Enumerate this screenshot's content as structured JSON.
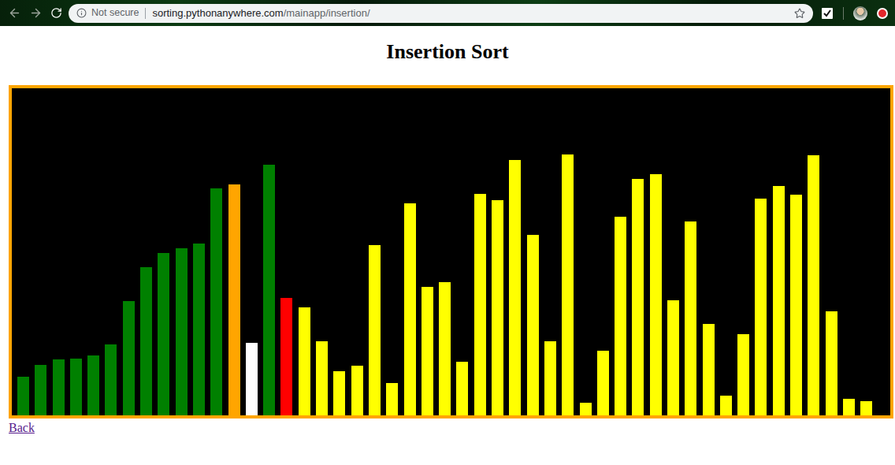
{
  "browser": {
    "security_label": "Not secure",
    "url_host": "sorting.pythonanywhere.com",
    "url_path": "/mainapp/insertion/"
  },
  "page": {
    "title": "Insertion Sort"
  },
  "chart": {
    "bars": [
      {
        "value": 49,
        "color": "#008000"
      },
      {
        "value": 64,
        "color": "#008000"
      },
      {
        "value": 71,
        "color": "#008000"
      },
      {
        "value": 72,
        "color": "#008000"
      },
      {
        "value": 76,
        "color": "#008000"
      },
      {
        "value": 90,
        "color": "#008000"
      },
      {
        "value": 145,
        "color": "#008000"
      },
      {
        "value": 188,
        "color": "#008000"
      },
      {
        "value": 206,
        "color": "#008000"
      },
      {
        "value": 212,
        "color": "#008000"
      },
      {
        "value": 218,
        "color": "#008000"
      },
      {
        "value": 288,
        "color": "#008000"
      },
      {
        "value": 293,
        "color": "#ffa500"
      },
      {
        "value": 92,
        "color": "#ffffff"
      },
      {
        "value": 318,
        "color": "#008000"
      },
      {
        "value": 149,
        "color": "#ff0000"
      },
      {
        "value": 137,
        "color": "#ffff00"
      },
      {
        "value": 94,
        "color": "#ffff00"
      },
      {
        "value": 56,
        "color": "#ffff00"
      },
      {
        "value": 63,
        "color": "#ffff00"
      },
      {
        "value": 216,
        "color": "#ffff00"
      },
      {
        "value": 41,
        "color": "#ffff00"
      },
      {
        "value": 269,
        "color": "#ffff00"
      },
      {
        "value": 163,
        "color": "#ffff00"
      },
      {
        "value": 169,
        "color": "#ffff00"
      },
      {
        "value": 68,
        "color": "#ffff00"
      },
      {
        "value": 281,
        "color": "#ffff00"
      },
      {
        "value": 273,
        "color": "#ffff00"
      },
      {
        "value": 324,
        "color": "#ffff00"
      },
      {
        "value": 229,
        "color": "#ffff00"
      },
      {
        "value": 94,
        "color": "#ffff00"
      },
      {
        "value": 331,
        "color": "#ffff00"
      },
      {
        "value": 16,
        "color": "#ffff00"
      },
      {
        "value": 82,
        "color": "#ffff00"
      },
      {
        "value": 252,
        "color": "#ffff00"
      },
      {
        "value": 300,
        "color": "#ffff00"
      },
      {
        "value": 306,
        "color": "#ffff00"
      },
      {
        "value": 146,
        "color": "#ffff00"
      },
      {
        "value": 246,
        "color": "#ffff00"
      },
      {
        "value": 116,
        "color": "#ffff00"
      },
      {
        "value": 25,
        "color": "#ffff00"
      },
      {
        "value": 103,
        "color": "#ffff00"
      },
      {
        "value": 275,
        "color": "#ffff00"
      },
      {
        "value": 291,
        "color": "#ffff00"
      },
      {
        "value": 280,
        "color": "#ffff00"
      },
      {
        "value": 330,
        "color": "#ffff00"
      },
      {
        "value": 132,
        "color": "#ffff00"
      },
      {
        "value": 21,
        "color": "#ffff00"
      },
      {
        "value": 18,
        "color": "#ffff00"
      }
    ]
  },
  "links": [
    {
      "label": "Back",
      "visited": true
    }
  ]
}
